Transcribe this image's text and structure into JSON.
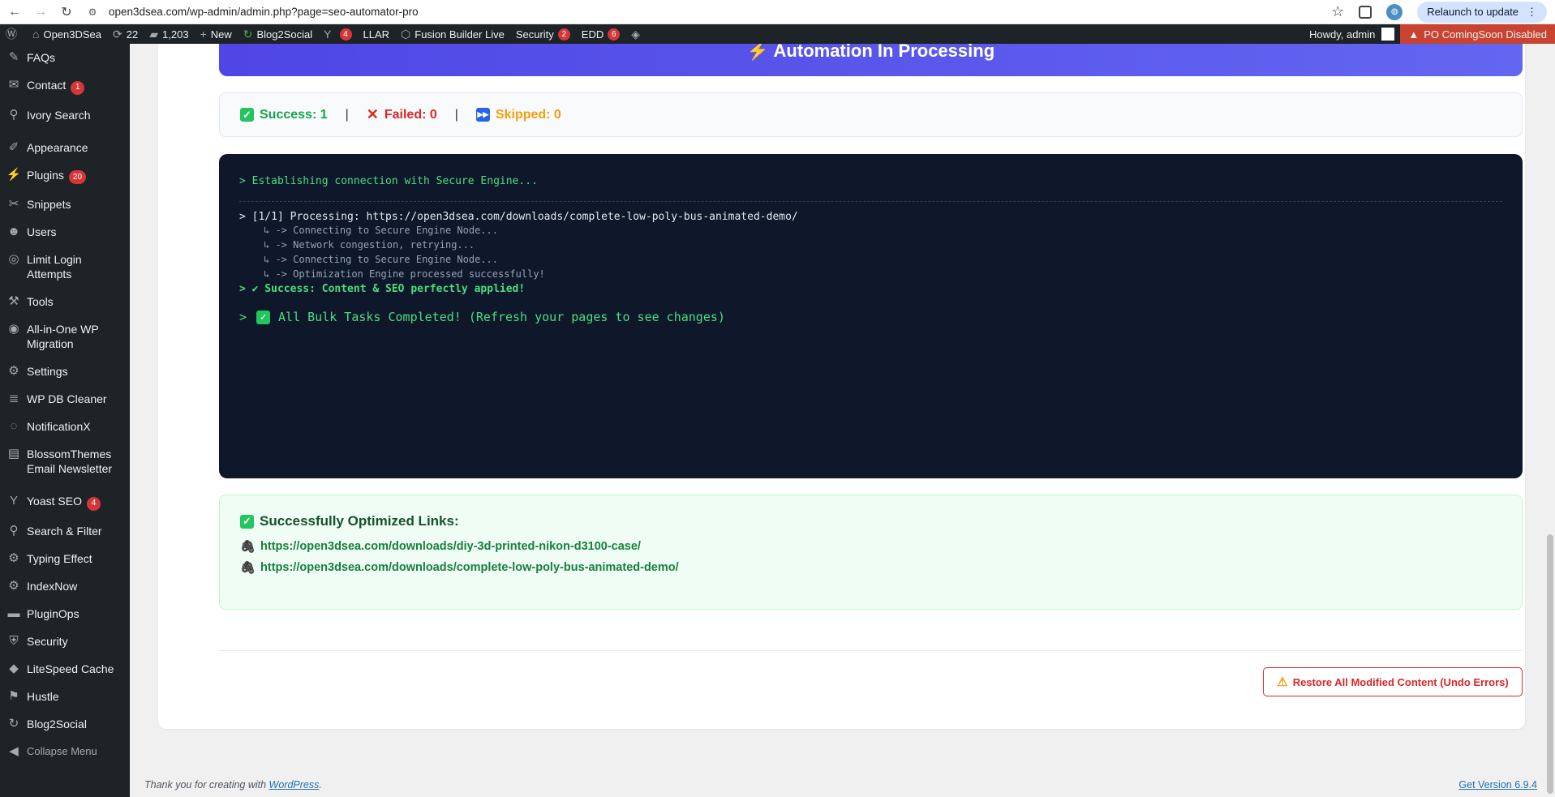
{
  "browser": {
    "url": "open3dsea.com/wp-admin/admin.php?page=seo-automator-pro",
    "relaunch_label": "Relaunch to update"
  },
  "adminbar": {
    "site_name": "Open3DSea",
    "updates_count": "22",
    "comments_count": "1,203",
    "new_label": "New",
    "blog2social_label": "Blog2Social",
    "yoast_badge": "4",
    "llar_label": "LLAR",
    "fusion_label": "Fusion Builder Live",
    "security_label": "Security",
    "security_badge": "2",
    "edd_label": "EDD",
    "edd_badge": "6",
    "howdy": "Howdy, admin",
    "coming_soon": "PO ComingSoon Disabled"
  },
  "sidebar": {
    "items": [
      {
        "label": "FAQs",
        "icon": "faq-icon"
      },
      {
        "label": "Contact",
        "icon": "mail-icon",
        "badge": "1"
      },
      {
        "label": "Ivory Search",
        "icon": "search-icon"
      },
      {
        "label": "Appearance",
        "icon": "brush-icon"
      },
      {
        "label": "Plugins",
        "icon": "plugin-icon",
        "badge": "20"
      },
      {
        "label": "Snippets",
        "icon": "snippets-icon"
      },
      {
        "label": "Users",
        "icon": "users-icon"
      },
      {
        "label": "Limit Login Attempts",
        "icon": "limit-login-icon"
      },
      {
        "label": "Tools",
        "icon": "wrench-icon"
      },
      {
        "label": "All-in-One WP Migration",
        "icon": "migration-icon"
      },
      {
        "label": "Settings",
        "icon": "settings-icon"
      },
      {
        "label": "WP DB Cleaner",
        "icon": "database-icon"
      },
      {
        "label": "NotificationX",
        "icon": "notification-icon"
      },
      {
        "label": "BlossomThemes Email Newsletter",
        "icon": "newsletter-icon"
      },
      {
        "label": "Yoast SEO",
        "icon": "yoast-icon",
        "badge": "4"
      },
      {
        "label": "Search & Filter",
        "icon": "search-icon"
      },
      {
        "label": "Typing Effect",
        "icon": "gear-icon"
      },
      {
        "label": "IndexNow",
        "icon": "gear-icon"
      },
      {
        "label": "PluginOps",
        "icon": "pluginops-icon"
      },
      {
        "label": "Security",
        "icon": "shield-icon"
      },
      {
        "label": "LiteSpeed Cache",
        "icon": "diamond-icon"
      },
      {
        "label": "Hustle",
        "icon": "hustle-icon"
      },
      {
        "label": "Blog2Social",
        "icon": "blog2social-icon"
      }
    ],
    "collapse_label": "Collapse Menu"
  },
  "main": {
    "hero_text": "⚡ Automation In Processing",
    "stats": {
      "success": "Success: 1",
      "failed": "Failed: 0",
      "skipped": "Skipped: 0",
      "separator": "|"
    },
    "terminal": {
      "line_connect": "> Establishing connection with Secure Engine...",
      "line_process": "> [1/1] Processing: https://open3dsea.com/downloads/complete-low-poly-bus-animated-demo/",
      "sub_lines": [
        "↳ -> Connecting to Secure Engine Node...",
        "↳ -> Network congestion, retrying...",
        "↳ -> Connecting to Secure Engine Node...",
        "↳ -> Optimization Engine processed successfully!"
      ],
      "line_success": "> ✔ Success: Content & SEO perfectly applied!",
      "done_prefix": ">",
      "done_text": "All Bulk Tasks Completed! (Refresh your pages to see changes)"
    },
    "optimized": {
      "title": "Successfully Optimized Links:",
      "links": [
        "https://open3dsea.com/downloads/diy-3d-printed-nikon-d3100-case/",
        "https://open3dsea.com/downloads/complete-low-poly-bus-animated-demo/"
      ]
    },
    "restore_label": "Restore All Modified Content (Undo Errors)"
  },
  "footer": {
    "thanks_prefix": "Thank you for creating with ",
    "wordpress_link": "WordPress",
    "thanks_suffix": ".",
    "version_link": "Get Version 6.9.4"
  },
  "colors": {
    "success": "#16a34a",
    "failed": "#dc2626",
    "skipped": "#f59e0b",
    "terminal_bg": "#0f172a",
    "admin_bg": "#1d2327"
  }
}
